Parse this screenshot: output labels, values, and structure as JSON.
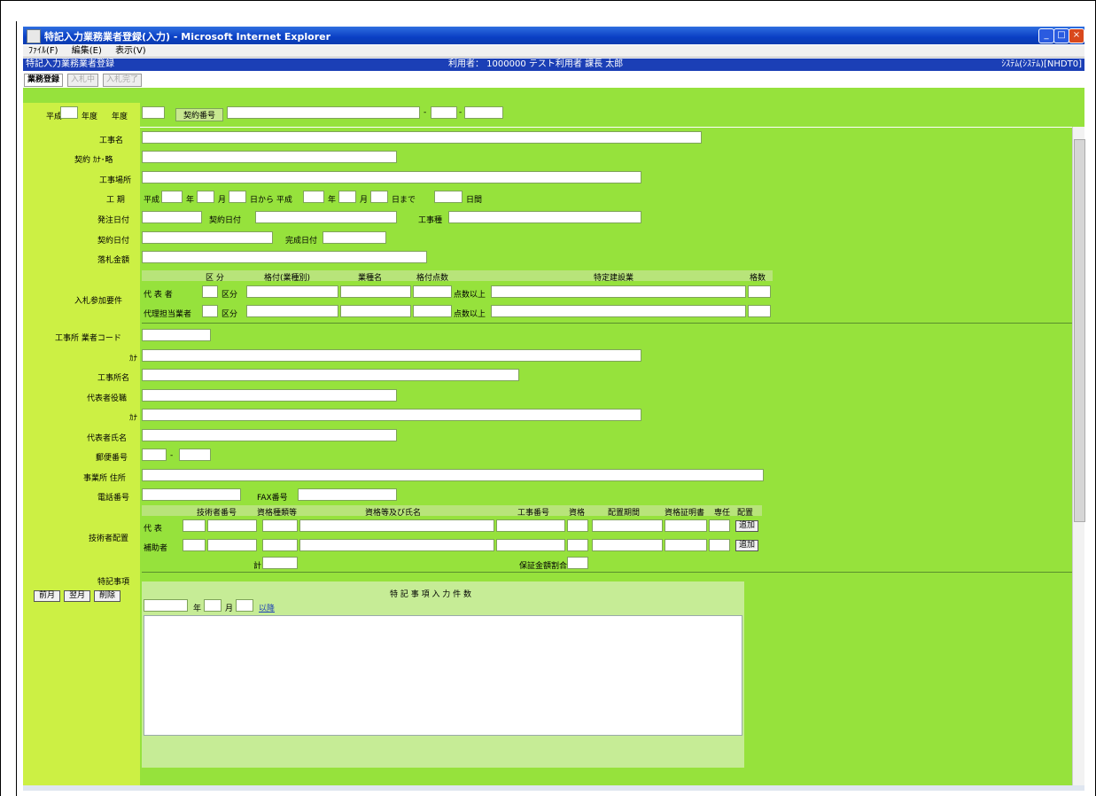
{
  "window": {
    "title": "特記入力業務業者登録(入力) - Microsoft Internet Explorer",
    "minimize": "_",
    "maximize": "□",
    "close": "×"
  },
  "menu": [
    "ﾌｧｲﾙ(F)",
    "編集(E)",
    "表示(V)"
  ],
  "header": {
    "left": "特記入力業務業者登録",
    "center": "利用者： 1000000  テスト利用者  課長  太郎",
    "right": "ｼｽﾃﾑ(ｼｽﾃﾑ)[NHDT0]"
  },
  "tabs": [
    {
      "label": "業務登録",
      "state": "active"
    },
    {
      "label": "入札中",
      "state": "off"
    },
    {
      "label": "入札完了",
      "state": "off"
    }
  ],
  "top_row": {
    "year_label": "平成",
    "year_unit": "年度",
    "year_suffix": "年度",
    "contract_no_label": "契約番号",
    "dash1": "-",
    "dash2": "-"
  },
  "form_labels": {
    "work_name": "工事名",
    "kana": "契約 ｶﾅ･略",
    "work_place": "工事場所",
    "period": "工 期",
    "period_era1": "平成",
    "period_year": "年",
    "period_month": "月",
    "period_from": "日から 平成",
    "period_until": "日まで",
    "period_days": "日間",
    "order_date": "発注日付",
    "contract_date": "契約日付",
    "work_type": "工事種",
    "pay_date": "契約日付",
    "completion": "完成日付",
    "amount": "落札金額",
    "bid_requirement": "入札参加要件",
    "contractor_code": "工事所 業者コード",
    "kana2": "ｶﾅ",
    "contractor_address": "工事所名",
    "rep_title": "代表者役職",
    "kana3": "ｶﾅ",
    "rep_name": "代表者氏名",
    "postal": "郵便番号",
    "office_address": "事業所 住所",
    "phone": "電話番号",
    "fax": "FAX番号",
    "engineers": "技術者配置",
    "total": "計",
    "guarantee_ratio": "保証金額割合",
    "remarks": "特記事項",
    "remarks_caption": "特 記 事 項 入 力 件 数",
    "remarks_unit_y": "年",
    "remarks_unit_m": "月",
    "remarks_link": "以降"
  },
  "requirement_table": {
    "headers": [
      "区 分",
      "格付(業種別)",
      "業種名",
      "格付点数",
      "特定建設業",
      "格数"
    ],
    "rows": [
      {
        "label": "代 表 者",
        "code": "区分"
      },
      {
        "label": "代理担当業者",
        "code": "区分"
      }
    ],
    "score_label": "点数以上"
  },
  "engineer_table": {
    "headers": [
      "技術者番号",
      "資格種類等",
      "資格等及び氏名",
      "工事番号",
      "資格",
      "配置期間",
      "資格証明書",
      "専任",
      "配置"
    ],
    "rows": [
      {
        "label": "代 表"
      },
      {
        "label": "補助者"
      }
    ],
    "add_button": "追加"
  },
  "left_buttons": [
    "前月",
    "翌月",
    "削除"
  ]
}
